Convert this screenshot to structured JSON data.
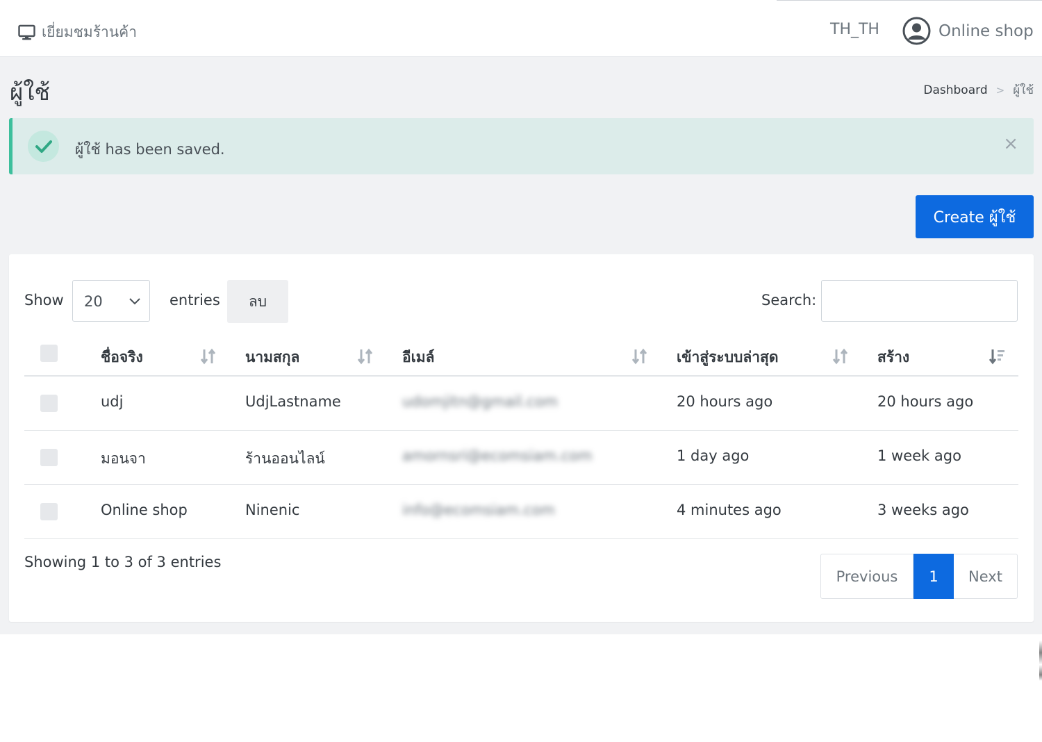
{
  "topbar": {
    "visit_store_label": "เยี่ยมชมร้านค้า",
    "language": "TH_TH",
    "user_name": "Online shop"
  },
  "page": {
    "title": "ผู้ใช้",
    "breadcrumb": {
      "home": "Dashboard",
      "separator": ">",
      "current": "ผู้ใช้"
    }
  },
  "alert": {
    "message": "ผู้ใช้ has been saved.",
    "close": "×"
  },
  "create_button": "Create ผู้ใช้",
  "table_controls": {
    "show_label": "Show",
    "length_value": "20",
    "entries_label": "entries",
    "delete_label": "ลบ",
    "search_label": "Search:",
    "search_value": ""
  },
  "table": {
    "columns": [
      "ชื่อจริง",
      "นามสกุล",
      "อีเมล์",
      "เข้าสู่ระบบล่าสุด",
      "สร้าง"
    ],
    "rows": [
      {
        "first_name": "udj",
        "last_name": "UdjLastname",
        "email": "udomjitn@gmail.com",
        "last_login": "20 hours ago",
        "created": "20 hours ago"
      },
      {
        "first_name": "มอนจา",
        "last_name": "ร้านออนไลน์",
        "email": "amornsri@ecomsiam.com",
        "last_login": "1 day ago",
        "created": "1 week ago"
      },
      {
        "first_name": "Online shop",
        "last_name": "Ninenic",
        "email": "info@ecomsiam.com",
        "last_login": "4 minutes ago",
        "created": "3 weeks ago"
      }
    ]
  },
  "footer": {
    "info": "Showing 1 to 3 of 3 entries",
    "pagination": {
      "previous": "Previous",
      "current_page": "1",
      "next": "Next"
    }
  },
  "colors": {
    "primary": "#0d6ae0",
    "success_border": "#3dbf9c",
    "alert_bg": "#dcecea",
    "content_bg": "#f1f2f4"
  }
}
